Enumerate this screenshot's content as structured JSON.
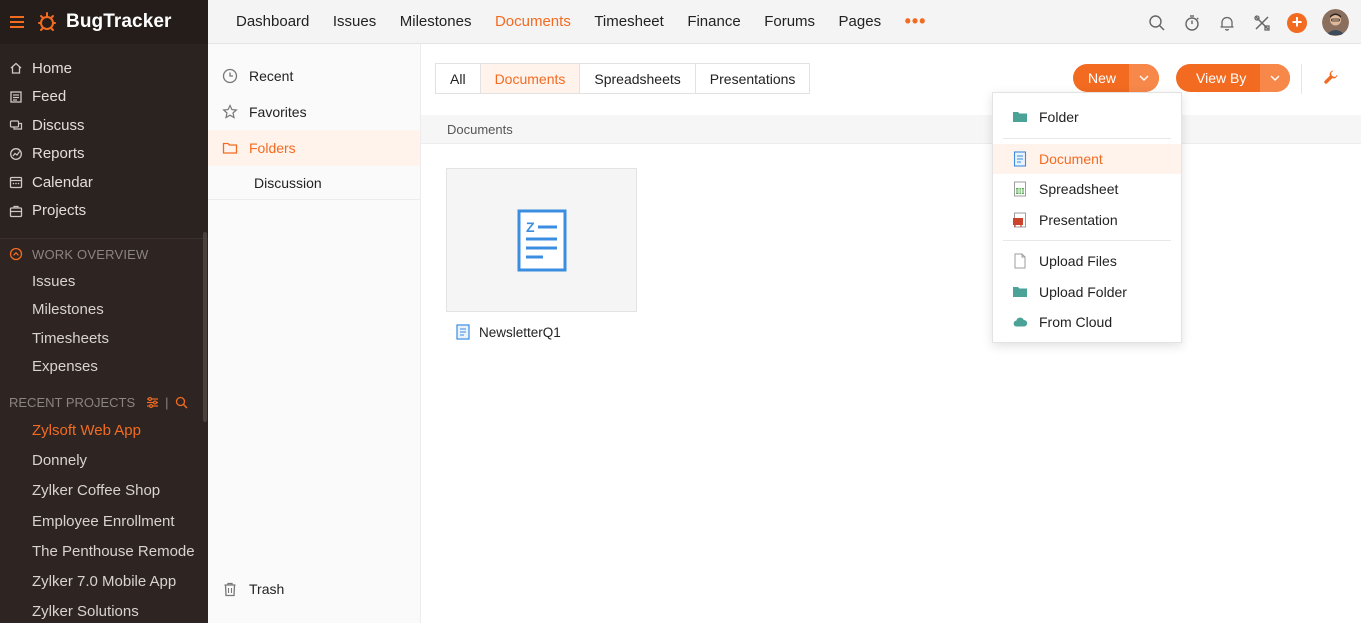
{
  "brand": {
    "name": "BugTracker"
  },
  "sidebar": {
    "main_items": [
      {
        "label": "Home",
        "icon": "home-icon"
      },
      {
        "label": "Feed",
        "icon": "feed-icon"
      },
      {
        "label": "Discuss",
        "icon": "discuss-icon"
      },
      {
        "label": "Reports",
        "icon": "reports-icon"
      },
      {
        "label": "Calendar",
        "icon": "calendar-icon"
      },
      {
        "label": "Projects",
        "icon": "projects-icon"
      }
    ],
    "work_overview": {
      "title": "WORK OVERVIEW",
      "items": [
        "Issues",
        "Milestones",
        "Timesheets",
        "Expenses"
      ]
    },
    "recent_projects": {
      "title": "RECENT PROJECTS",
      "items": [
        "Zylsoft Web App",
        "Donnely",
        "Zylker Coffee Shop",
        "Employee Enrollment",
        "The Penthouse Remode",
        "Zylker 7.0 Mobile App",
        "Zylker Solutions"
      ],
      "active_index": 0
    }
  },
  "topnav": {
    "items": [
      "Dashboard",
      "Issues",
      "Milestones",
      "Documents",
      "Timesheet",
      "Finance",
      "Forums",
      "Pages"
    ],
    "active": "Documents",
    "more": "•••"
  },
  "docs_sidebar": {
    "items": [
      {
        "label": "Recent",
        "icon": "clock-icon"
      },
      {
        "label": "Favorites",
        "icon": "star-icon"
      },
      {
        "label": "Folders",
        "icon": "folder-icon"
      }
    ],
    "sub_item": "Discussion",
    "trash": "Trash"
  },
  "filters": {
    "items": [
      "All",
      "Documents",
      "Spreadsheets",
      "Presentations"
    ],
    "active": "Documents"
  },
  "buttons": {
    "new": "New",
    "view_by": "View By"
  },
  "breadcrumb": "Documents",
  "files": [
    {
      "name": "NewsletterQ1"
    }
  ],
  "new_menu": {
    "group1": [
      {
        "label": "Folder",
        "icon": "folder-icon"
      }
    ],
    "group2": [
      {
        "label": "Document",
        "icon": "document-icon"
      },
      {
        "label": "Spreadsheet",
        "icon": "spreadsheet-icon"
      },
      {
        "label": "Presentation",
        "icon": "presentation-icon"
      }
    ],
    "group3": [
      {
        "label": "Upload Files",
        "icon": "upload-file-icon"
      },
      {
        "label": "Upload Folder",
        "icon": "upload-folder-icon"
      },
      {
        "label": "From Cloud",
        "icon": "cloud-icon"
      }
    ],
    "hovered": "Document"
  },
  "colors": {
    "accent": "#f26b21",
    "sidebar_bg": "#2b2320",
    "doc_blue": "#3b8de0",
    "folder_teal": "#4aa396"
  }
}
